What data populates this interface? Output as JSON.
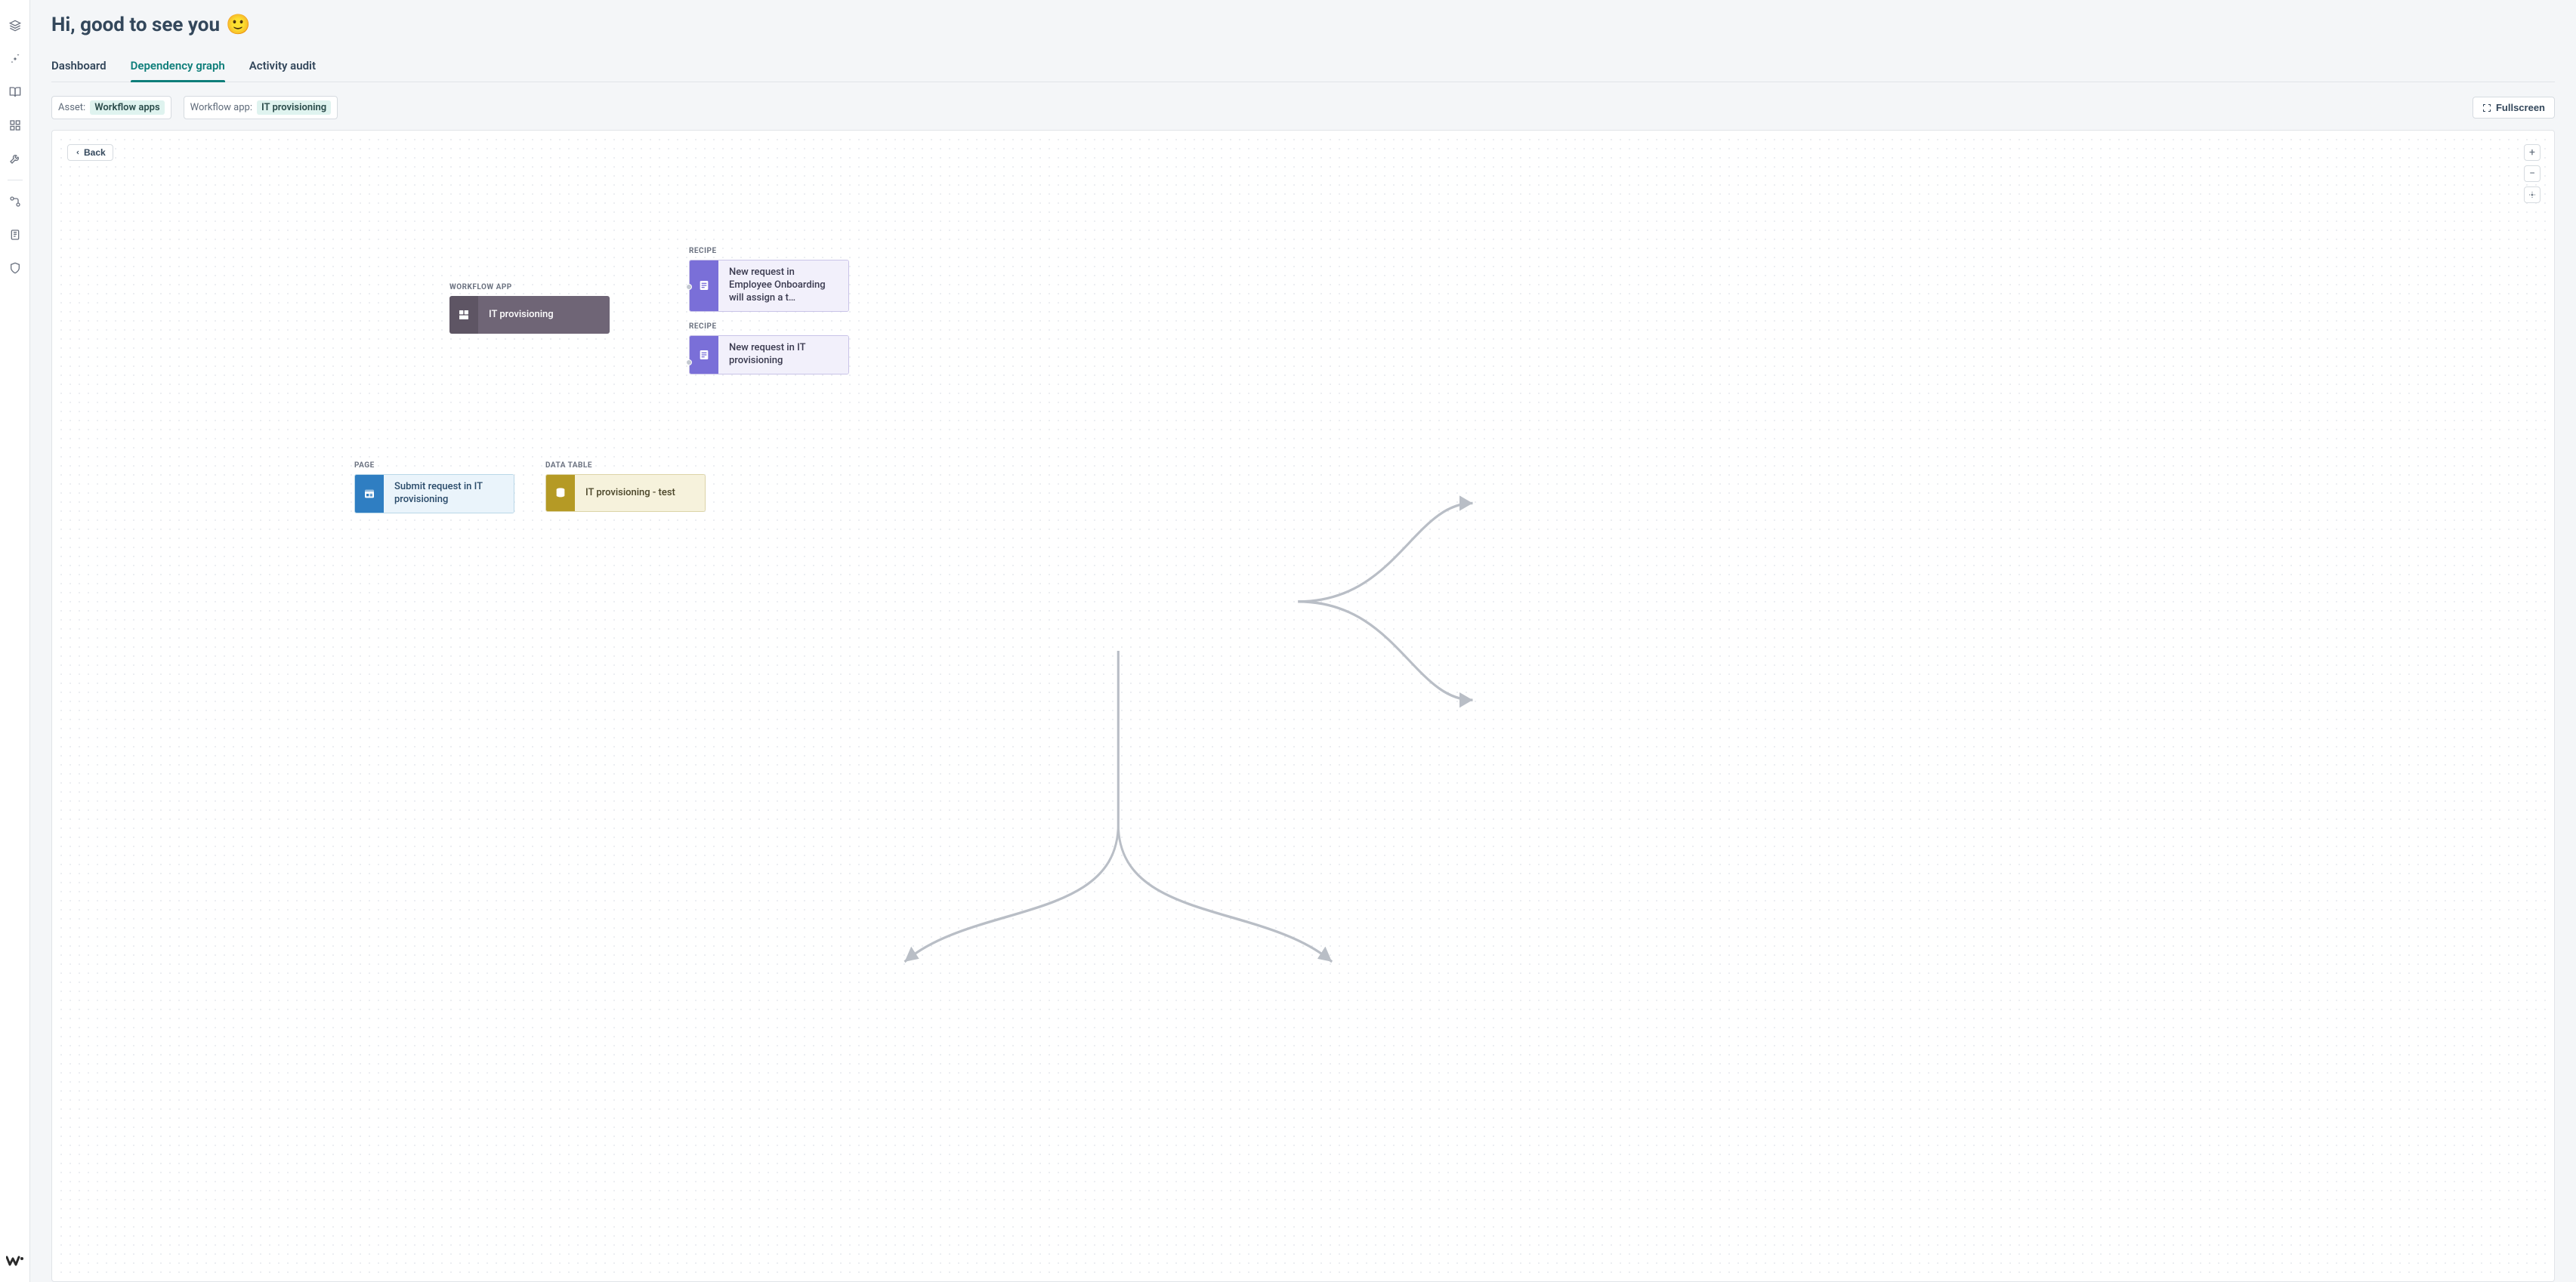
{
  "page": {
    "title_text": "Hi, good to see you",
    "title_emoji": "🙂"
  },
  "tabs": [
    {
      "label": "Dashboard",
      "active": false
    },
    {
      "label": "Dependency graph",
      "active": true
    },
    {
      "label": "Activity audit",
      "active": false
    }
  ],
  "filters": {
    "asset": {
      "label": "Asset:",
      "value": "Workflow apps"
    },
    "workflow_app": {
      "label": "Workflow app:",
      "value": "IT provisioning"
    }
  },
  "buttons": {
    "fullscreen": "Fullscreen",
    "back": "Back"
  },
  "sidebar_icons": [
    "layers-icon",
    "settings-icon",
    "book-icon",
    "grid-icon",
    "wrench-icon",
    "flow-icon",
    "clipboard-icon",
    "shield-icon"
  ],
  "graph": {
    "workflow_app": {
      "type_label": "WORKFLOW APP",
      "title": "IT provisioning"
    },
    "recipes": [
      {
        "type_label": "RECIPE",
        "title": "New request in Employee Onboarding will assign a t…"
      },
      {
        "type_label": "RECIPE",
        "title": "New request in IT provisioning"
      }
    ],
    "page": {
      "type_label": "PAGE",
      "title": "Submit request in IT provisioning"
    },
    "data_table": {
      "type_label": "DATA TABLE",
      "title": "IT provisioning - test"
    }
  }
}
